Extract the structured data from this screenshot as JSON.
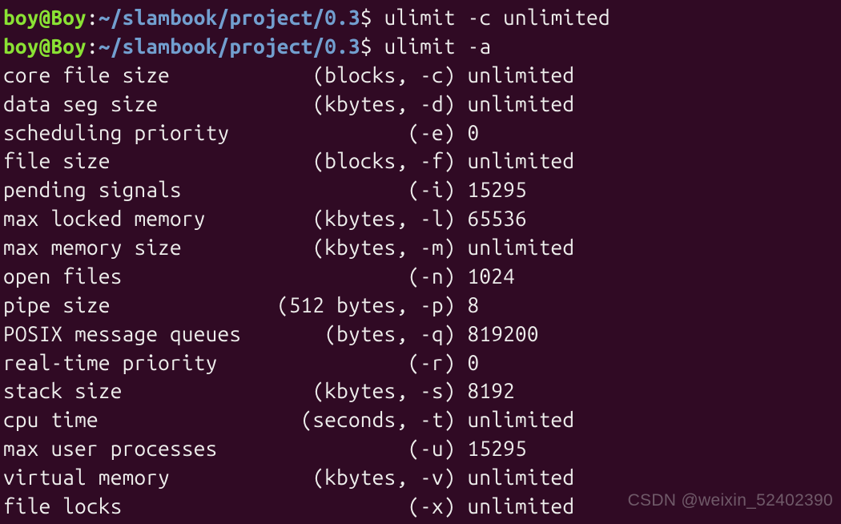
{
  "prompt": {
    "user": "boy@Boy",
    "sep": ":",
    "path": "~/slambook/project/0.3",
    "dollar": "$"
  },
  "commands": {
    "line1": "ulimit -c unlimited",
    "line2": "ulimit -a"
  },
  "ulimit_output": [
    {
      "name": "core file size",
      "unit": "(blocks, -c)",
      "value": "unlimited"
    },
    {
      "name": "data seg size",
      "unit": "(kbytes, -d)",
      "value": "unlimited"
    },
    {
      "name": "scheduling priority",
      "unit": "(-e)",
      "value": "0"
    },
    {
      "name": "file size",
      "unit": "(blocks, -f)",
      "value": "unlimited"
    },
    {
      "name": "pending signals",
      "unit": "(-i)",
      "value": "15295"
    },
    {
      "name": "max locked memory",
      "unit": "(kbytes, -l)",
      "value": "65536"
    },
    {
      "name": "max memory size",
      "unit": "(kbytes, -m)",
      "value": "unlimited"
    },
    {
      "name": "open files",
      "unit": "(-n)",
      "value": "1024"
    },
    {
      "name": "pipe size",
      "unit": "(512 bytes, -p)",
      "value": "8"
    },
    {
      "name": "POSIX message queues",
      "unit": "(bytes, -q)",
      "value": "819200"
    },
    {
      "name": "real-time priority",
      "unit": "(-r)",
      "value": "0"
    },
    {
      "name": "stack size",
      "unit": "(kbytes, -s)",
      "value": "8192"
    },
    {
      "name": "cpu time",
      "unit": "(seconds, -t)",
      "value": "unlimited"
    },
    {
      "name": "max user processes",
      "unit": "(-u)",
      "value": "15295"
    },
    {
      "name": "virtual memory",
      "unit": "(kbytes, -v)",
      "value": "unlimited"
    },
    {
      "name": "file locks",
      "unit": "(-x)",
      "value": "unlimited"
    }
  ],
  "layout": {
    "name_width": 23,
    "unit_width": 15
  },
  "watermark": "CSDN @weixin_52402390"
}
